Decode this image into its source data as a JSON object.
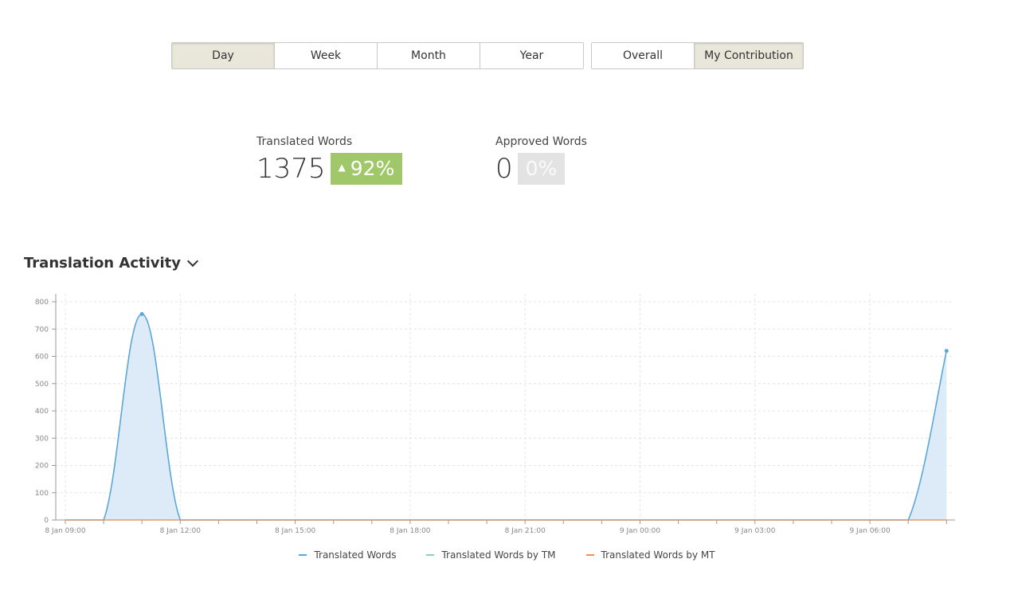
{
  "periods": [
    "Day",
    "Week",
    "Month",
    "Year"
  ],
  "active_period": "Day",
  "scope": [
    "Overall",
    "My Contribution"
  ],
  "active_scope": "My Contribution",
  "stats": {
    "translated": {
      "label": "Translated Words",
      "value": "1375",
      "change": "92%",
      "trend": "up"
    },
    "approved": {
      "label": "Approved Words",
      "value": "0",
      "change": "0%"
    }
  },
  "section_title": "Translation Activity",
  "icons": {
    "dropdown": "chevron-down-icon",
    "trend": "triangle-up-icon"
  },
  "colors": {
    "translated": "#5aa8d6",
    "translated_fill": "#dcebf7",
    "tm": "#8fd1a8",
    "mt": "#e89060",
    "badge_up": "#a0c86a"
  },
  "chart_data": {
    "type": "area",
    "title": "",
    "xlabel": "",
    "ylabel": "",
    "ylim": [
      0,
      800
    ],
    "yticks": [
      0,
      100,
      200,
      300,
      400,
      500,
      600,
      700,
      800
    ],
    "grid": true,
    "legend_position": "bottom",
    "x_hours": [
      0,
      1,
      2,
      3,
      4,
      5,
      6,
      7,
      8,
      9,
      10,
      11,
      12,
      13,
      14,
      15,
      16,
      17,
      18,
      19,
      20,
      21,
      22,
      23
    ],
    "x_tick_labels": [
      {
        "hour": 0,
        "label": "8 Jan 09:00"
      },
      {
        "hour": 3,
        "label": "8 Jan 12:00"
      },
      {
        "hour": 6,
        "label": "8 Jan 15:00"
      },
      {
        "hour": 9,
        "label": "8 Jan 18:00"
      },
      {
        "hour": 12,
        "label": "8 Jan 21:00"
      },
      {
        "hour": 15,
        "label": "9 Jan 00:00"
      },
      {
        "hour": 18,
        "label": "9 Jan 03:00"
      },
      {
        "hour": 21,
        "label": "9 Jan 06:00"
      }
    ],
    "series": [
      {
        "name": "Translated Words",
        "values": [
          0,
          0,
          755,
          0,
          0,
          0,
          0,
          0,
          0,
          0,
          0,
          0,
          0,
          0,
          0,
          0,
          0,
          0,
          0,
          0,
          0,
          0,
          0,
          620
        ]
      },
      {
        "name": "Translated Words by TM",
        "values": [
          0,
          0,
          0,
          0,
          0,
          0,
          0,
          0,
          0,
          0,
          0,
          0,
          0,
          0,
          0,
          0,
          0,
          0,
          0,
          0,
          0,
          0,
          0,
          0
        ]
      },
      {
        "name": "Translated Words by MT",
        "values": [
          0,
          0,
          0,
          0,
          0,
          0,
          0,
          0,
          0,
          0,
          0,
          0,
          0,
          0,
          0,
          0,
          0,
          0,
          0,
          0,
          0,
          0,
          0,
          0
        ]
      }
    ]
  }
}
